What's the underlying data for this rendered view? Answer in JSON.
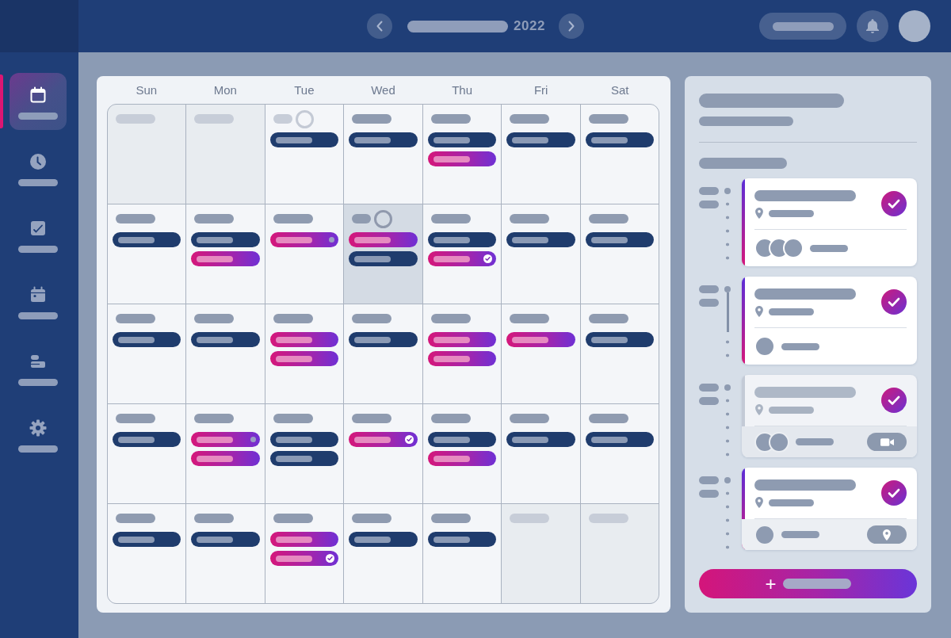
{
  "top_bar": {
    "year": "2022"
  },
  "sidebar": {
    "items": [
      {
        "selected": true
      },
      {
        "selected": false
      },
      {
        "selected": false
      },
      {
        "selected": false
      },
      {
        "selected": false
      },
      {
        "selected": false
      }
    ]
  },
  "calendar": {
    "weekdays": [
      "Sun",
      "Mon",
      "Tue",
      "Wed",
      "Thu",
      "Fri",
      "Sat"
    ],
    "weeks": [
      [
        {
          "outside": true,
          "selected": false,
          "marked": false
        },
        {
          "outside": true,
          "selected": false,
          "marked": false
        },
        {
          "outside": false,
          "selected": false,
          "marked": true,
          "events": [
            {
              "kind": "meeting",
              "done": false,
              "pending": false
            }
          ]
        },
        {
          "outside": false,
          "selected": false,
          "marked": false,
          "events": [
            {
              "kind": "meeting",
              "done": false,
              "pending": false
            }
          ]
        },
        {
          "outside": false,
          "selected": false,
          "marked": false,
          "events": [
            {
              "kind": "meeting",
              "done": false,
              "pending": false
            },
            {
              "kind": "highlight",
              "done": false,
              "pending": false
            }
          ]
        },
        {
          "outside": false,
          "selected": false,
          "marked": false,
          "events": [
            {
              "kind": "meeting",
              "done": false,
              "pending": false
            }
          ]
        },
        {
          "outside": false,
          "selected": false,
          "marked": false,
          "events": [
            {
              "kind": "meeting",
              "done": false,
              "pending": false
            }
          ]
        }
      ],
      [
        {
          "outside": false,
          "selected": false,
          "marked": false,
          "events": [
            {
              "kind": "meeting",
              "done": false,
              "pending": false
            }
          ]
        },
        {
          "outside": false,
          "selected": false,
          "marked": false,
          "events": [
            {
              "kind": "meeting",
              "done": false,
              "pending": false
            },
            {
              "kind": "highlight",
              "done": false,
              "pending": false
            }
          ]
        },
        {
          "outside": false,
          "selected": false,
          "marked": false,
          "events": [
            {
              "kind": "highlight",
              "done": false,
              "pending": true
            }
          ]
        },
        {
          "outside": false,
          "selected": true,
          "marked": true,
          "events": [
            {
              "kind": "highlight",
              "done": false,
              "pending": false
            },
            {
              "kind": "meeting",
              "done": false,
              "pending": false
            }
          ]
        },
        {
          "outside": false,
          "selected": false,
          "marked": false,
          "events": [
            {
              "kind": "meeting",
              "done": false,
              "pending": false
            },
            {
              "kind": "highlight",
              "done": true,
              "pending": false
            }
          ]
        },
        {
          "outside": false,
          "selected": false,
          "marked": false,
          "events": [
            {
              "kind": "meeting",
              "done": false,
              "pending": false
            }
          ]
        },
        {
          "outside": false,
          "selected": false,
          "marked": false,
          "events": [
            {
              "kind": "meeting",
              "done": false,
              "pending": false
            }
          ]
        }
      ],
      [
        {
          "outside": false,
          "selected": false,
          "marked": false,
          "events": [
            {
              "kind": "meeting",
              "done": false,
              "pending": false
            }
          ]
        },
        {
          "outside": false,
          "selected": false,
          "marked": false,
          "events": [
            {
              "kind": "meeting",
              "done": false,
              "pending": false
            }
          ]
        },
        {
          "outside": false,
          "selected": false,
          "marked": false,
          "events": [
            {
              "kind": "highlight",
              "done": false,
              "pending": false
            },
            {
              "kind": "highlight",
              "done": false,
              "pending": false
            }
          ]
        },
        {
          "outside": false,
          "selected": false,
          "marked": false,
          "events": [
            {
              "kind": "meeting",
              "done": false,
              "pending": false
            }
          ]
        },
        {
          "outside": false,
          "selected": false,
          "marked": false,
          "events": [
            {
              "kind": "highlight",
              "done": false,
              "pending": false
            },
            {
              "kind": "highlight",
              "done": false,
              "pending": false
            }
          ]
        },
        {
          "outside": false,
          "selected": false,
          "marked": false,
          "events": [
            {
              "kind": "highlight",
              "done": false,
              "pending": false
            }
          ]
        },
        {
          "outside": false,
          "selected": false,
          "marked": false,
          "events": [
            {
              "kind": "meeting",
              "done": false,
              "pending": false
            }
          ]
        }
      ],
      [
        {
          "outside": false,
          "selected": false,
          "marked": false,
          "events": [
            {
              "kind": "meeting",
              "done": false,
              "pending": false
            }
          ]
        },
        {
          "outside": false,
          "selected": false,
          "marked": false,
          "events": [
            {
              "kind": "highlight",
              "done": false,
              "pending": true
            },
            {
              "kind": "highlight",
              "done": false,
              "pending": false
            }
          ]
        },
        {
          "outside": false,
          "selected": false,
          "marked": false,
          "events": [
            {
              "kind": "meeting",
              "done": false,
              "pending": false
            },
            {
              "kind": "meeting",
              "done": false,
              "pending": false
            }
          ]
        },
        {
          "outside": false,
          "selected": false,
          "marked": false,
          "events": [
            {
              "kind": "highlight",
              "done": true,
              "pending": false
            }
          ]
        },
        {
          "outside": false,
          "selected": false,
          "marked": false,
          "events": [
            {
              "kind": "meeting",
              "done": false,
              "pending": false
            },
            {
              "kind": "highlight",
              "done": false,
              "pending": false
            }
          ]
        },
        {
          "outside": false,
          "selected": false,
          "marked": false,
          "events": [
            {
              "kind": "meeting",
              "done": false,
              "pending": false
            }
          ]
        },
        {
          "outside": false,
          "selected": false,
          "marked": false,
          "events": [
            {
              "kind": "meeting",
              "done": false,
              "pending": false
            }
          ]
        }
      ],
      [
        {
          "outside": false,
          "selected": false,
          "marked": false,
          "events": [
            {
              "kind": "meeting",
              "done": false,
              "pending": false
            }
          ]
        },
        {
          "outside": false,
          "selected": false,
          "marked": false,
          "events": [
            {
              "kind": "meeting",
              "done": false,
              "pending": false
            }
          ]
        },
        {
          "outside": false,
          "selected": false,
          "marked": false,
          "events": [
            {
              "kind": "highlight",
              "done": false,
              "pending": false
            },
            {
              "kind": "highlight",
              "done": true,
              "pending": false
            }
          ]
        },
        {
          "outside": false,
          "selected": false,
          "marked": false,
          "events": [
            {
              "kind": "meeting",
              "done": false,
              "pending": false
            }
          ]
        },
        {
          "outside": false,
          "selected": false,
          "marked": false,
          "events": [
            {
              "kind": "meeting",
              "done": false,
              "pending": false
            }
          ]
        },
        {
          "outside": true,
          "selected": false,
          "marked": false
        },
        {
          "outside": true,
          "selected": false,
          "marked": false
        }
      ]
    ]
  },
  "agenda": {
    "items": [
      {
        "checked": true,
        "current": false,
        "faded": false,
        "attendees": [
          {
            "kind": "avatar"
          },
          {
            "kind": "avatar"
          },
          {
            "kind": "avatar"
          }
        ]
      },
      {
        "checked": true,
        "current": true,
        "faded": false,
        "attendees": [
          {
            "kind": "avatar"
          }
        ]
      },
      {
        "checked": true,
        "current": false,
        "faded": true,
        "attendees": [
          {
            "kind": "avatar"
          },
          {
            "kind": "avatar"
          }
        ],
        "action": {
          "kind": "call"
        }
      },
      {
        "checked": true,
        "current": false,
        "faded": false,
        "attendees": [
          {
            "kind": "avatar"
          }
        ],
        "action": {
          "kind": "location"
        }
      }
    ]
  },
  "add_button": {
    "label": "+"
  }
}
